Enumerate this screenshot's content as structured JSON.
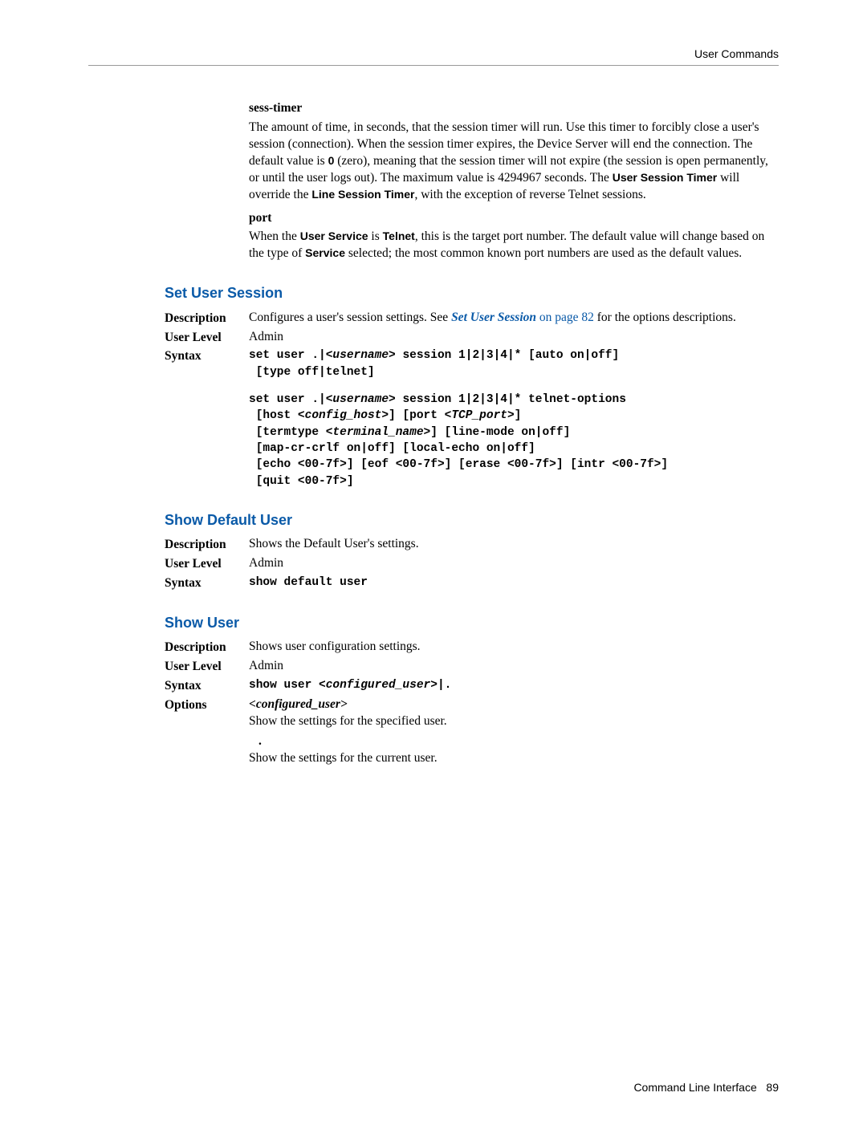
{
  "header": {
    "right": "User Commands"
  },
  "sess_timer": {
    "title": "sess-timer",
    "text_pre": "The amount of time, in seconds, that the session timer will run. Use this timer to forcibly close a user's session (connection). When the session timer expires, the Device Server will end the connection. The default value is ",
    "bold_zero": "0",
    "text_mid": " (zero), meaning that the session timer will not expire (the session is open permanently, or until the user logs out). The maximum value is 4294967 seconds. The ",
    "bold_ust": "User Session Timer",
    "text_mid2": " will override the ",
    "bold_lst": "Line Session Timer",
    "text_post": ", with the exception of reverse Telnet sessions."
  },
  "port": {
    "title": "port",
    "t1": "When the ",
    "b1": "User Service",
    "t2": " is ",
    "b2": "Telnet",
    "t3": ", this is the target port number. The default value will change based on the type of ",
    "b3": "Service",
    "t4": " selected; the most common known port numbers are used as the default values."
  },
  "sections": {
    "set_user_session": {
      "heading": "Set User Session",
      "desc_label": "Description",
      "desc_pre": "Configures a user's session settings. See ",
      "desc_link": "Set User Session",
      "desc_linkpage": " on page 82",
      "desc_post": " for the options descriptions.",
      "level_label": "User Level",
      "level_value": "Admin",
      "syntax_label": "Syntax",
      "syntax_block1": "set user .|<username> session 1|2|3|4|* [auto on|off]\n [type off|telnet]",
      "syntax_block2": "set user .|<username> session 1|2|3|4|* telnet-options\n [host <config_host>] [port <TCP_port>]\n [termtype <terminal_name>] [line-mode on|off]\n [map-cr-crlf on|off] [local-echo on|off]\n [echo <00-7f>] [eof <00-7f>] [erase <00-7f>] [intr <00-7f>]\n [quit <00-7f>]"
    },
    "show_default_user": {
      "heading": "Show Default User",
      "desc_label": "Description",
      "desc": "Shows the Default User's settings.",
      "level_label": "User Level",
      "level_value": "Admin",
      "syntax_label": "Syntax",
      "syntax": "show default user"
    },
    "show_user": {
      "heading": "Show User",
      "desc_label": "Description",
      "desc": "Shows user configuration settings.",
      "level_label": "User Level",
      "level_value": "Admin",
      "syntax_label": "Syntax",
      "syntax": "show user <configured_user>|.",
      "options_label": "Options",
      "opt1_name": "<configured_user>",
      "opt1_text": "Show the settings for the specified user.",
      "opt2_name": ".",
      "opt2_text": "Show the settings for the current user."
    }
  },
  "footer": {
    "left": "Command Line Interface",
    "page": "89"
  }
}
